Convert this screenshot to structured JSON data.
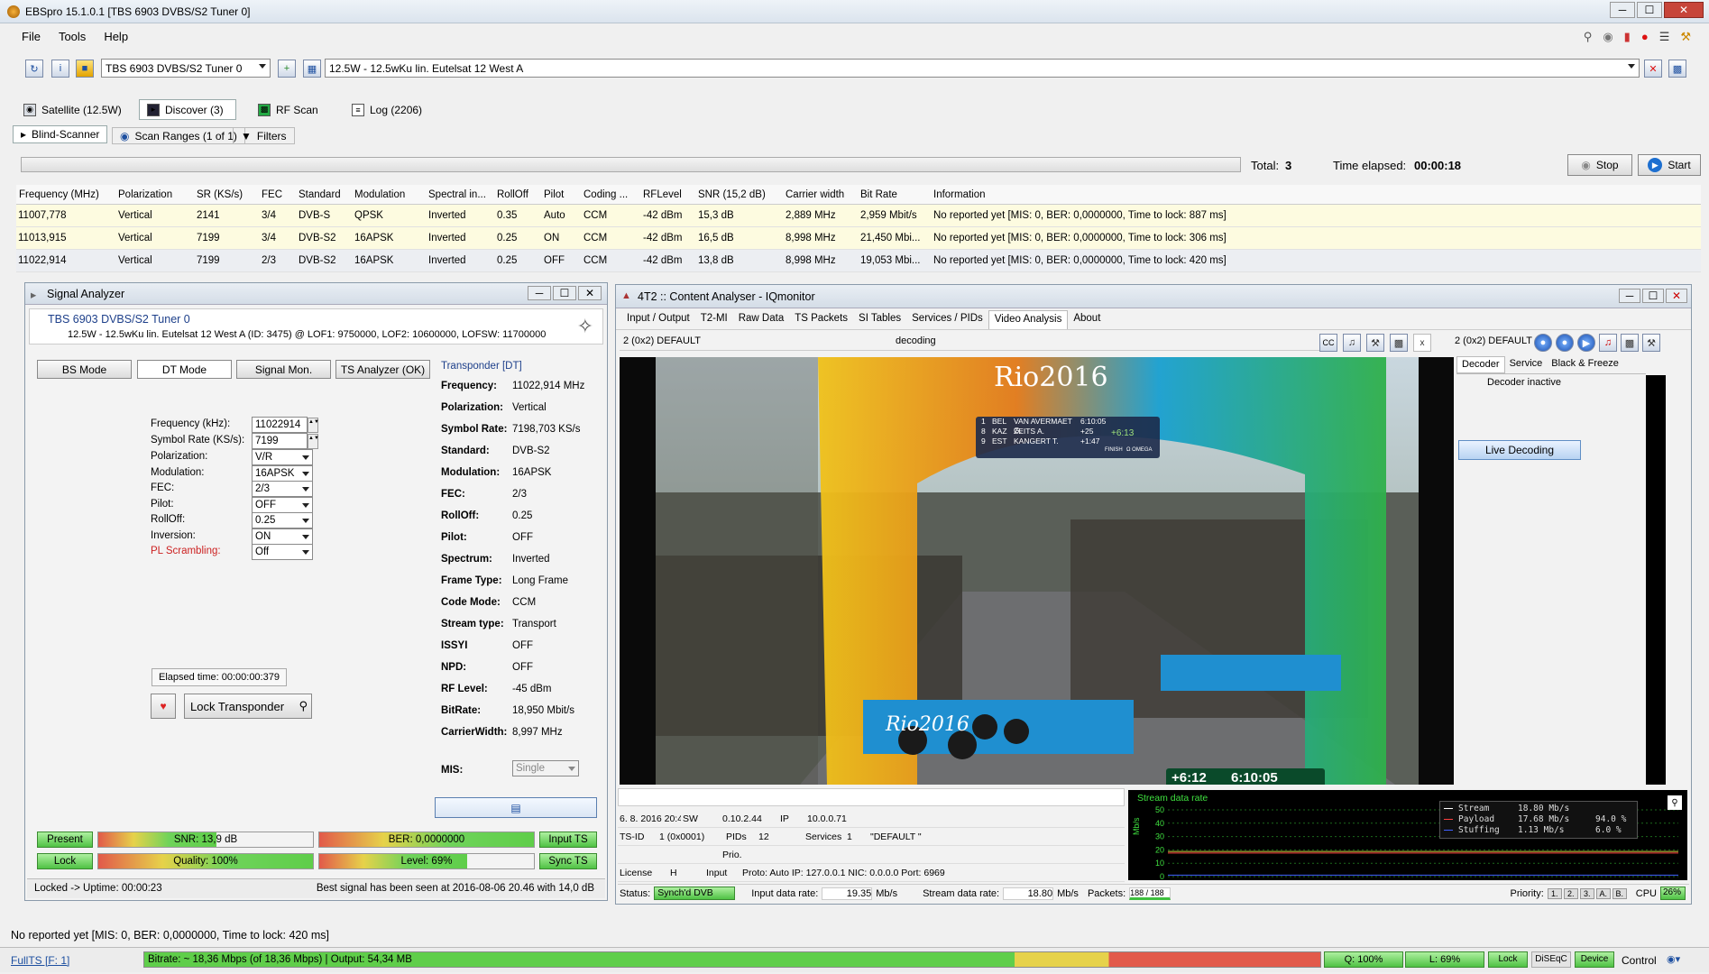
{
  "window": {
    "title": "EBSpro 15.1.0.1 [TBS 6903 DVBS/S2 Tuner 0]",
    "minimize": "─",
    "maximize": "☐",
    "close": "✕"
  },
  "menu": [
    "File",
    "Tools",
    "Help"
  ],
  "toolbar": {
    "tuner": "TBS 6903 DVBS/S2 Tuner 0",
    "satellite": "12.5W - 12.5wKu lin. Eutelsat 12 West A"
  },
  "tabs": {
    "satellite": "Satellite (12.5W)",
    "discover": "Discover (3)",
    "rfscan": "RF Scan",
    "log": "Log (2206)"
  },
  "subtabs": {
    "blind": "Blind-Scanner",
    "ranges": "Scan Ranges (1 of 1)",
    "filters": "Filters"
  },
  "scan": {
    "total_label": "Total:",
    "total": "3",
    "elapsed_label": "Time elapsed:",
    "elapsed": "00:00:18",
    "stop": "Stop",
    "start": "Start"
  },
  "columns": [
    "Frequency (MHz)",
    "Polarization",
    "SR (KS/s)",
    "FEC",
    "Standard",
    "Modulation",
    "Spectral in...",
    "RollOff",
    "Pilot",
    "Coding ...",
    "RFLevel",
    "SNR (15,2 dB)",
    "Carrier width",
    "Bit Rate",
    "Information"
  ],
  "rows": [
    [
      "11007,778",
      "Vertical",
      "2141",
      "3/4",
      "DVB-S",
      "QPSK",
      "Inverted",
      "0.35",
      "Auto",
      "CCM",
      "-42 dBm",
      "15,3 dB",
      "2,889 MHz",
      "2,959 Mbit/s",
      "No reported yet [MIS: 0, BER: 0,0000000, Time to lock: 887 ms]"
    ],
    [
      "11013,915",
      "Vertical",
      "7199",
      "3/4",
      "DVB-S2",
      "16APSK",
      "Inverted",
      "0.25",
      "ON",
      "CCM",
      "-42 dBm",
      "16,5 dB",
      "8,998 MHz",
      "21,450 Mbi...",
      "No reported yet [MIS: 0, BER: 0,0000000, Time to lock: 306 ms]"
    ],
    [
      "11022,914",
      "Vertical",
      "7199",
      "2/3",
      "DVB-S2",
      "16APSK",
      "Inverted",
      "0.25",
      "OFF",
      "CCM",
      "-42 dBm",
      "13,8 dB",
      "8,998 MHz",
      "19,053 Mbi...",
      "No reported yet [MIS: 0, BER: 0,0000000, Time to lock: 420 ms]"
    ]
  ],
  "signal": {
    "title": "Signal Analyzer",
    "tuner": "TBS 6903 DVBS/S2 Tuner 0",
    "info": "12.5W - 12.5wKu lin. Eutelsat 12 West A (ID: 3475) @ LOF1: 9750000, LOF2: 10600000, LOFSW: 11700000",
    "modes": [
      "BS Mode",
      "DT Mode",
      "Signal Mon.",
      "TS Analyzer (OK)"
    ],
    "form": [
      {
        "label": "Frequency (kHz):",
        "value": "11022914"
      },
      {
        "label": "Symbol Rate (KS/s):",
        "value": "7199"
      },
      {
        "label": "Polarization:",
        "value": "V/R"
      },
      {
        "label": "Modulation:",
        "value": "16APSK"
      },
      {
        "label": "FEC:",
        "value": "2/3"
      },
      {
        "label": "Pilot:",
        "value": "OFF"
      },
      {
        "label": "RollOff:",
        "value": "0.25"
      },
      {
        "label": "Inversion:",
        "value": "ON"
      },
      {
        "label": "PL Scrambling:",
        "value": "Off"
      }
    ],
    "elapsed": "Elapsed time: 00:00:00:379",
    "lock_btn": "Lock Transponder",
    "transponder_title": "Transponder [DT]",
    "transponder": [
      {
        "k": "Frequency:",
        "v": "11022,914 MHz"
      },
      {
        "k": "Polarization:",
        "v": "Vertical"
      },
      {
        "k": "Symbol Rate:",
        "v": "7198,703 KS/s"
      },
      {
        "k": "Standard:",
        "v": "DVB-S2"
      },
      {
        "k": "Modulation:",
        "v": "16APSK"
      },
      {
        "k": "FEC:",
        "v": "2/3"
      },
      {
        "k": "RollOff:",
        "v": "0.25"
      },
      {
        "k": "Pilot:",
        "v": "OFF"
      },
      {
        "k": "Spectrum:",
        "v": "Inverted"
      },
      {
        "k": "Frame Type:",
        "v": "Long Frame"
      },
      {
        "k": "Code Mode:",
        "v": "CCM"
      },
      {
        "k": "Stream type:",
        "v": "Transport"
      },
      {
        "k": "ISSYI",
        "v": "OFF"
      },
      {
        "k": "NPD:",
        "v": "OFF"
      },
      {
        "k": "RF Level:",
        "v": "-45 dBm"
      },
      {
        "k": "BitRate:",
        "v": "18,950 Mbit/s"
      },
      {
        "k": "CarrierWidth:",
        "v": "8,997 MHz"
      }
    ],
    "mis_label": "MIS:",
    "mis_value": "Single",
    "present": "Present",
    "lock": "Lock",
    "snr": "SNR: 13,9 dB",
    "snr_level": 0.55,
    "ber": "BER: 0,0000000",
    "quality": "Quality: 100%",
    "quality_level": 1.0,
    "level": "Level: 69%",
    "level_level": 0.69,
    "input_ts": "Input TS",
    "sync_ts": "Sync TS",
    "uptime": "Locked -> Uptime: 00:00:23",
    "best": "Best signal has been seen at 2016-08-06 20.46 with 14,0 dB"
  },
  "iq": {
    "title": "4T2 :: Content Analyser - IQmonitor",
    "menu": [
      "Input / Output",
      "T2-MI",
      "Raw Data",
      "TS Packets",
      "SI Tables",
      "Services / PIDs",
      "Video Analysis",
      "About"
    ],
    "service": "2 (0x2) DEFAULT",
    "decoding": "decoding",
    "service2": "2 (0x2) DEFAULT",
    "side_tabs": [
      "Decoder",
      "Service",
      "Black & Freeze"
    ],
    "decoder_inactive": "Decoder inactive",
    "live": "Live Decoding",
    "video": {
      "banner": "Rio2016",
      "scores": [
        [
          "1",
          "BEL",
          "VAN AVERMAET G.",
          "6:10:05"
        ],
        [
          "8",
          "KAZ",
          "ZEITS A.",
          "+25"
        ],
        [
          "9",
          "EST",
          "KANGERT T.",
          "+1:47"
        ]
      ],
      "clock": "6:10:05",
      "diff": "+6:12",
      "gap": "+6:13",
      "finish": "FINISH",
      "omega": "Ω OMEGA",
      "board": "Rio2016"
    },
    "info_rows": [
      [
        "6. 8. 2016 20:46:21",
        "SW",
        "0.10.2.44",
        "IP",
        "10.0.0.71"
      ],
      [
        "TS-ID",
        "1 (0x0001)",
        "PIDs",
        "12",
        "Services",
        "1",
        "\"DEFAULT \""
      ],
      [
        "",
        "",
        "Prio.",
        "",
        "",
        ""
      ],
      [
        "License",
        "H",
        "Input",
        "Proto: Auto IP: 127.0.0.1 NIC: 0.0.0.0 Port: 6969"
      ]
    ],
    "chart_title": "Stream data rate",
    "chart_ylabel": "Mb/s",
    "legend": [
      {
        "name": "Stream",
        "value": "18.80 Mb/s",
        "pct": "",
        "color": "#ffffff"
      },
      {
        "name": "Payload",
        "value": "17.68 Mb/s",
        "pct": "94.0 %",
        "color": "#ff4040"
      },
      {
        "name": "Stuffing",
        "value": "1.13 Mb/s",
        "pct": "6.0 %",
        "color": "#4060ff"
      }
    ],
    "status_label": "Status:",
    "status": "Synch'd DVB",
    "input_rate_label": "Input data rate:",
    "input_rate": "19.35",
    "mbs": "Mb/s",
    "stream_rate_label": "Stream data rate:",
    "stream_rate": "18.80",
    "mbs2": "Mb/s",
    "packets_label": "Packets:",
    "packets": "188 / 188",
    "priority_label": "Priority:",
    "priorities": [
      "1.",
      "2.",
      "3.",
      "A.",
      "B."
    ],
    "cpu_label": "CPU",
    "cpu": "26%"
  },
  "chart_data": {
    "type": "line",
    "title": "Stream data rate",
    "ylabel": "Mb/s",
    "ylim": [
      0,
      50
    ],
    "yticks": [
      0,
      10,
      20,
      30,
      40,
      50
    ],
    "series": [
      {
        "name": "Stream",
        "value": 18.8
      },
      {
        "name": "Payload",
        "value": 17.68
      },
      {
        "name": "Stuffing",
        "value": 1.13
      }
    ]
  },
  "statusbar": {
    "message": "No reported yet [MIS: 0, BER: 0,0000000, Time to lock: 420 ms]",
    "fullts": "FullTS [F: 1]",
    "bitrate": "Bitrate: ~ 18,36 Mbps (of 18,36 Mbps) | Output: 54,34 MB",
    "q": "Q: 100%",
    "l": "L: 69%",
    "lock": "Lock",
    "diseqc": "DiSEqC",
    "device": "Device",
    "control": "Control"
  },
  "colors": {
    "accent": "#1d4fa0",
    "ok": "#4fc244",
    "warn": "#e6c43a",
    "bad": "#e25a4a"
  }
}
